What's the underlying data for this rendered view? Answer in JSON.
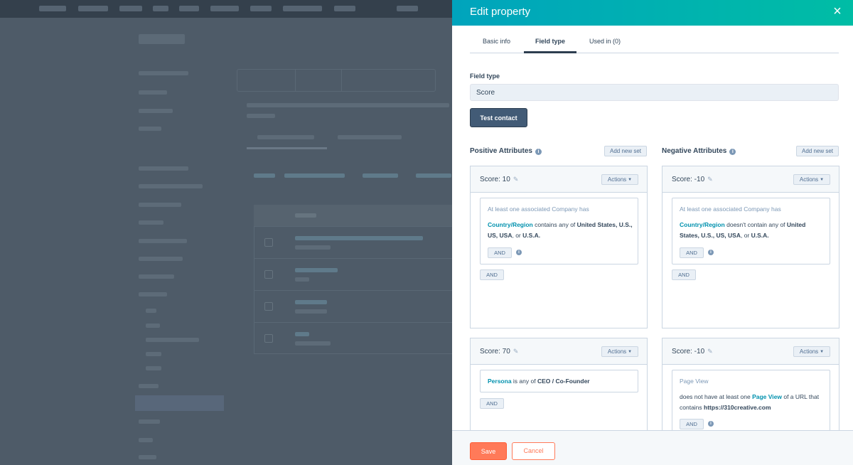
{
  "panel": {
    "title": "Edit property",
    "close_icon": "×"
  },
  "tabs": [
    {
      "label": "Basic info"
    },
    {
      "label": "Field type"
    },
    {
      "label": "Used in (0)"
    }
  ],
  "field_type": {
    "label": "Field type",
    "value": "Score",
    "test_button": "Test contact"
  },
  "positive": {
    "title": "Positive Attributes",
    "add_set": "Add new set",
    "cards": [
      {
        "score": "Score: 10",
        "actions": "Actions",
        "heading": "At least one associated Company has",
        "link": "Country/Region",
        "op": " contains any of ",
        "vals": "United States, U.S., US, USA",
        "or": ", or ",
        "last": "U.S.A.",
        "inner_and": "AND",
        "outer_and": "AND"
      },
      {
        "score": "Score: 70",
        "actions": "Actions",
        "link": "Persona",
        "op": " is any of ",
        "vals": "CEO / Co-Founder",
        "outer_and": "AND"
      }
    ]
  },
  "negative": {
    "title": "Negative Attributes",
    "add_set": "Add new set",
    "cards": [
      {
        "score": "Score: -10",
        "actions": "Actions",
        "heading": "At least one associated Company has",
        "link": "Country/Region",
        "op": " doesn't contain any of ",
        "vals": "United States, U.S., US, USA",
        "or": ", or ",
        "last": "U.S.A.",
        "inner_and": "AND",
        "outer_and": "AND"
      },
      {
        "score": "Score: -10",
        "actions": "Actions",
        "heading": "Page View",
        "pre": "does not have at least one ",
        "link": "Page View",
        "op": " of a URL that contains ",
        "vals": "https://310creative.com",
        "inner_and": "AND"
      }
    ]
  },
  "footer": {
    "save": "Save",
    "cancel": "Cancel"
  },
  "colors": {
    "header_start": "#00a4bd",
    "header_end": "#00bda5",
    "save": "#ff7a59",
    "link": "#0091ae",
    "dark_button": "#425b76"
  }
}
